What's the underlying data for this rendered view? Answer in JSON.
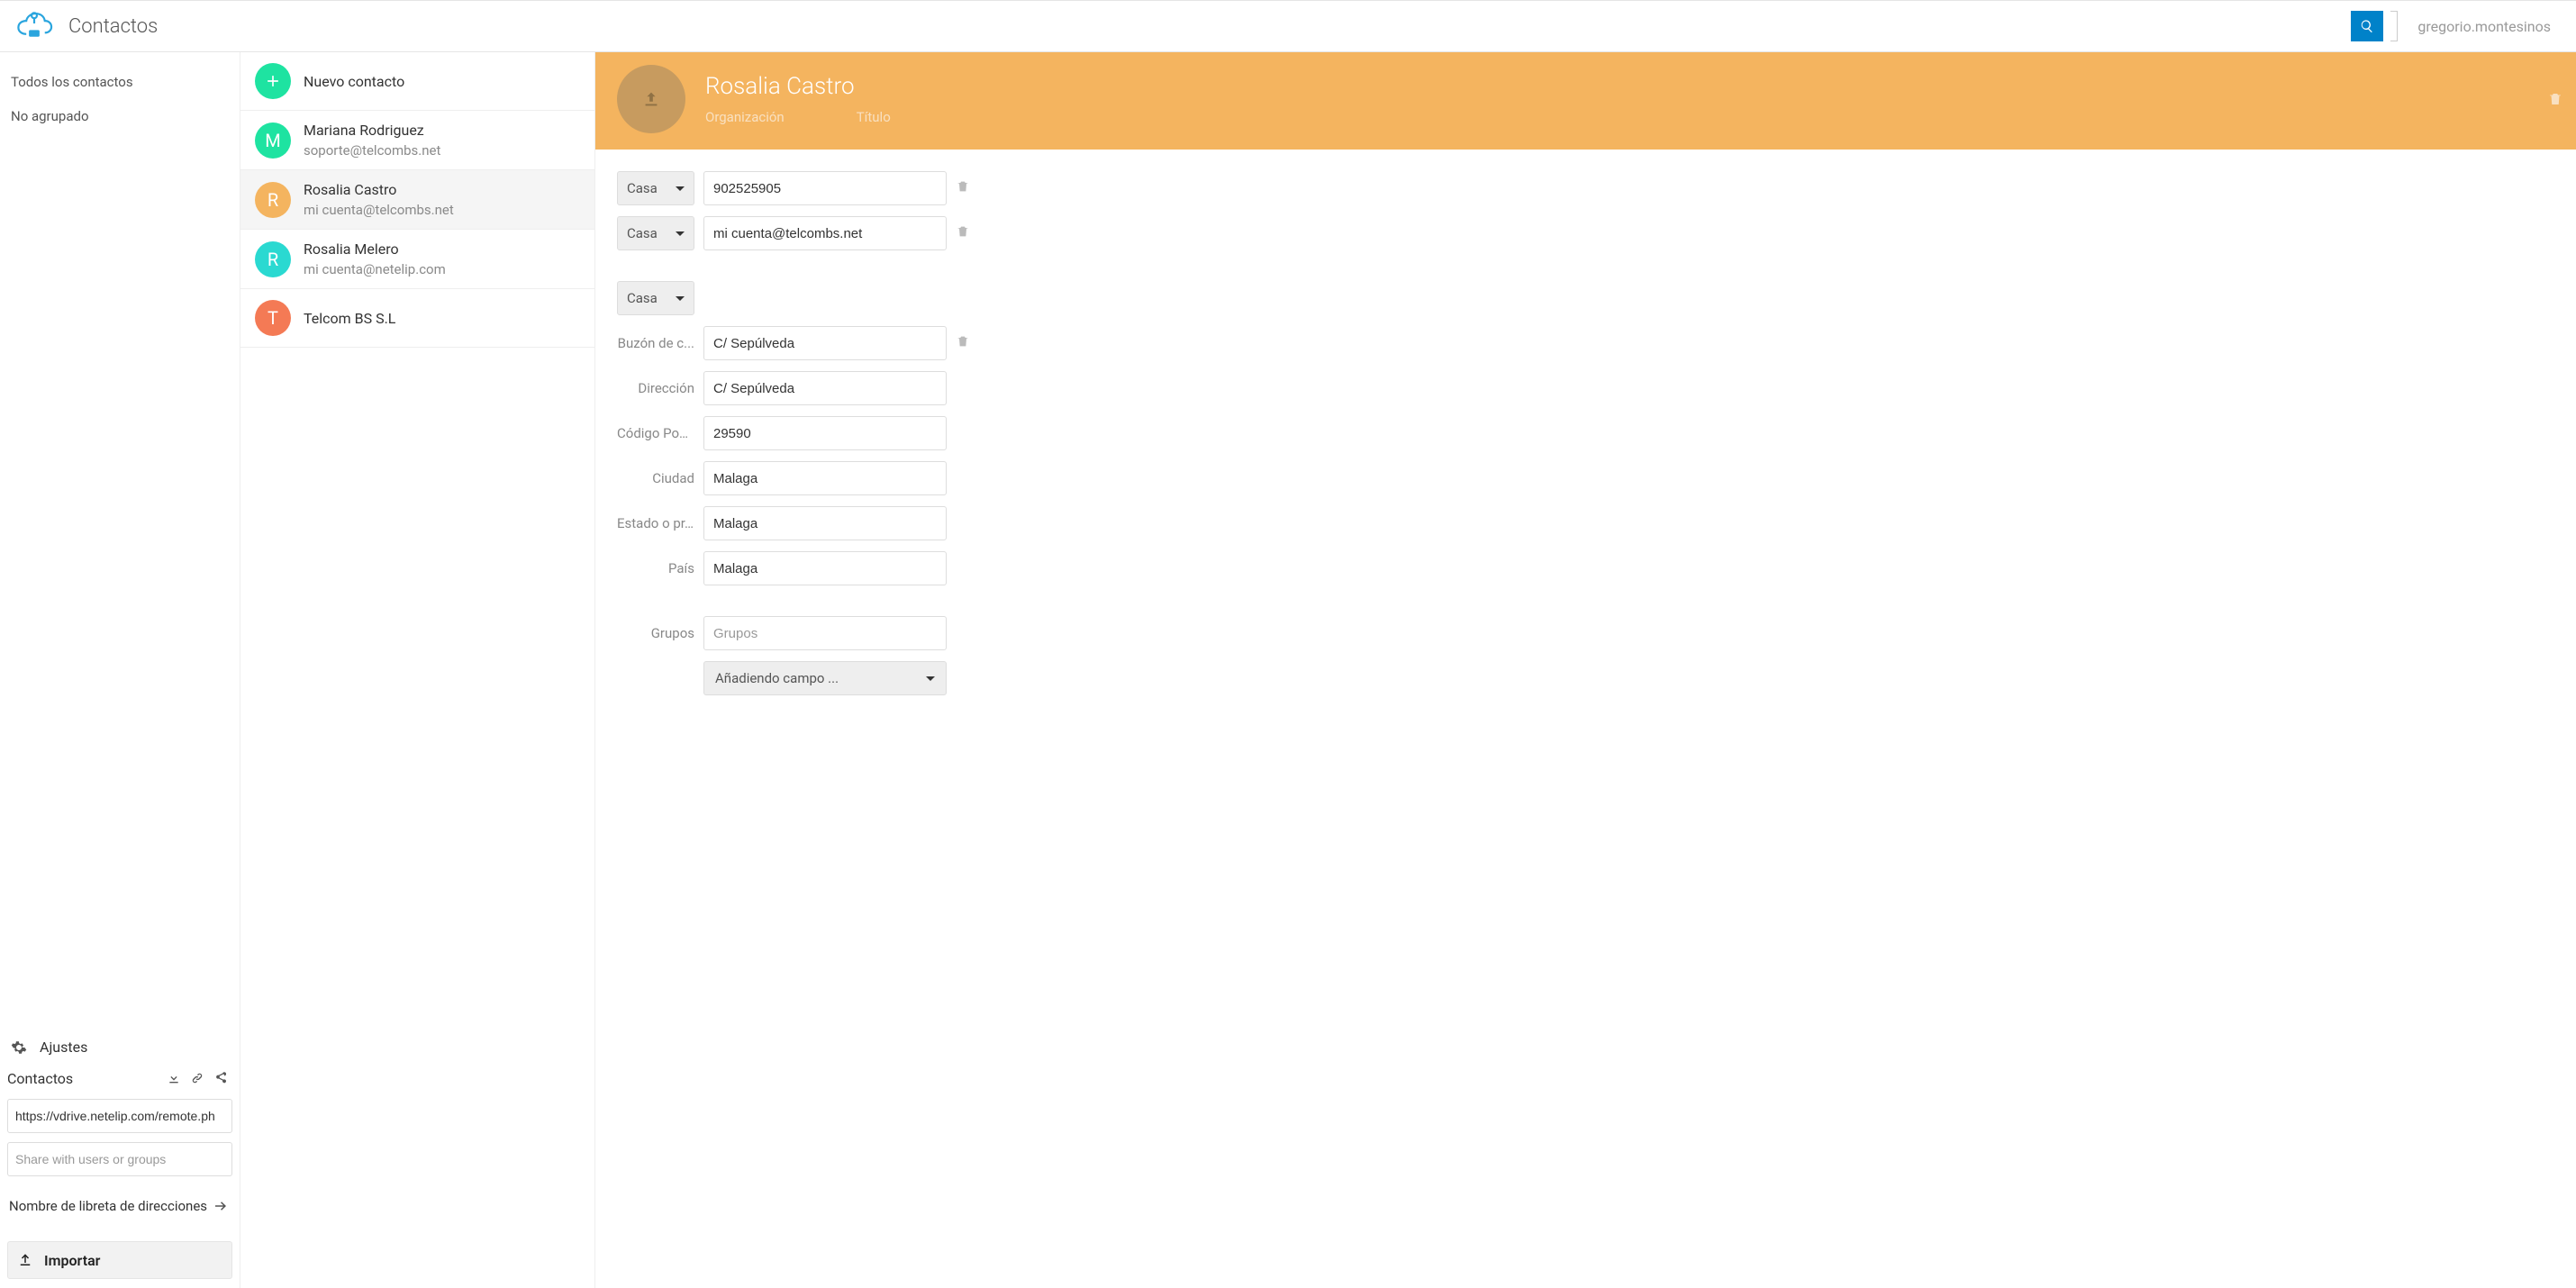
{
  "header": {
    "app_title": "Contactos",
    "user": "gregorio.montesinos"
  },
  "sidebar": {
    "nav": [
      {
        "label": "Todos los contactos"
      },
      {
        "label": "No agrupado"
      }
    ],
    "settings_label": "Ajustes",
    "panel": {
      "title": "Contactos",
      "url_value": "https://vdrive.netelip.com/remote.ph",
      "share_placeholder": "Share with users or groups",
      "book_label": "Nombre de libreta de direcciones"
    },
    "import_label": "Importar"
  },
  "list": {
    "new_label": "Nuevo contacto",
    "items": [
      {
        "initial": "M",
        "color": "#1ee3a1",
        "name": "Mariana Rodriguez",
        "sub": "soporte@telcombs.net"
      },
      {
        "initial": "R",
        "color": "#f4b45f",
        "name": "Rosalia Castro",
        "sub": "mi cuenta@telcombs.net",
        "active": true
      },
      {
        "initial": "R",
        "color": "#2ad9d1",
        "name": "Rosalia Melero",
        "sub": "mi cuenta@netelip.com"
      },
      {
        "initial": "T",
        "color": "#f47a55",
        "name": "Telcom BS S.L",
        "sub": ""
      }
    ]
  },
  "detail": {
    "name": "Rosalia Castro",
    "meta": {
      "org_label": "Organización",
      "title_label": "Título"
    },
    "phone": {
      "type_label": "Casa",
      "value": "902525905"
    },
    "email": {
      "type_label": "Casa",
      "value": "mi cuenta@telcombs.net"
    },
    "address": {
      "type_label": "Casa",
      "pobox_label": "Buzón de c...",
      "pobox_value": "C/ Sepúlveda",
      "addr_label": "Dirección",
      "addr_value": "C/ Sepúlveda",
      "postal_label": "Código Postal",
      "postal_value": "29590",
      "city_label": "Ciudad",
      "city_value": "Malaga",
      "state_label": "Estado o pr...",
      "state_value": "Malaga",
      "country_label": "País",
      "country_value": "Malaga"
    },
    "groups": {
      "label": "Grupos",
      "placeholder": "Grupos"
    },
    "add_field_label": "Añadiendo campo ..."
  }
}
